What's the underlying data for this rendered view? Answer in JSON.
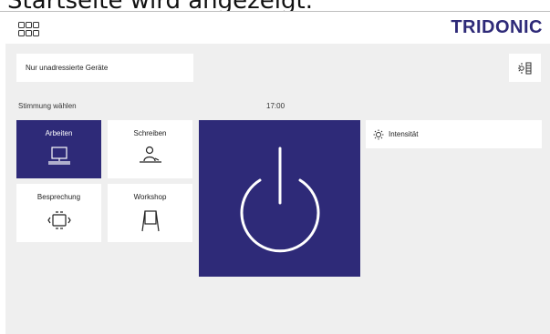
{
  "caption": "Startseite wird angezeigt.",
  "header": {
    "logo": "TRIDONIC",
    "menu_icon": "app-grid-icon"
  },
  "filter": {
    "label": "Nur unadressierte Geräte"
  },
  "tweak_icon": "room-settings-icon",
  "scenes": {
    "title": "Stimmung wählen",
    "items": [
      {
        "label": "Arbeiten",
        "icon": "desk-monitor-icon",
        "active": true
      },
      {
        "label": "Schreiben",
        "icon": "person-writing-icon",
        "active": false
      },
      {
        "label": "Besprechung",
        "icon": "meeting-table-icon",
        "active": false
      },
      {
        "label": "Workshop",
        "icon": "flipchart-icon",
        "active": false
      }
    ]
  },
  "clock": "17:00",
  "power_icon": "power-icon",
  "intensity": {
    "label": "Intensität",
    "icon": "sun-icon"
  },
  "colors": {
    "brand": "#2e2a78",
    "background": "#efefef",
    "tile": "#ffffff"
  }
}
